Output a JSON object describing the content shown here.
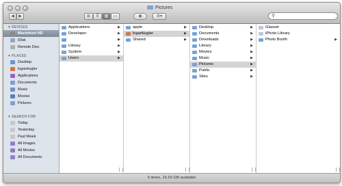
{
  "window": {
    "title": "Pictures"
  },
  "toolbar": {
    "back_glyph": "◀",
    "forward_glyph": "▶",
    "view_icon_glyph": "⊞",
    "view_list_glyph": "☰",
    "view_column_glyph": "▥",
    "view_coverflow_glyph": "▭",
    "eye_glyph": "◉",
    "gear_glyph": "⚙▾",
    "search_glyph": "⚲",
    "search_value": ""
  },
  "sidebar": {
    "devices_header": "DEVICES",
    "places_header": "PLACES",
    "search_header": "SEARCH FOR",
    "devices": [
      {
        "label": "Macintosh HD",
        "icon": "hard-drive-icon",
        "color": "#8a8a8a"
      },
      {
        "label": "iDisk",
        "icon": "idisk-icon",
        "color": "#9aa7b8"
      },
      {
        "label": "Remote Disc",
        "icon": "remote-disc-icon",
        "color": "#b0b0b0"
      }
    ],
    "places": [
      {
        "label": "Desktop",
        "icon": "desktop-icon",
        "color": "#6f94c8"
      },
      {
        "label": "logankugler",
        "icon": "home-icon",
        "color": "#c87a4a"
      },
      {
        "label": "Applications",
        "icon": "applications-icon",
        "color": "#a05fbf"
      },
      {
        "label": "Documents",
        "icon": "documents-icon",
        "color": "#7fa0d0"
      },
      {
        "label": "Music",
        "icon": "music-icon",
        "color": "#6f94c8"
      },
      {
        "label": "Movies",
        "icon": "movies-icon",
        "color": "#5f7fb8"
      },
      {
        "label": "Pictures",
        "icon": "pictures-icon",
        "color": "#7fa0d0"
      }
    ],
    "searches": [
      {
        "label": "Today",
        "icon": "clock-icon",
        "color": "#c8c8c8"
      },
      {
        "label": "Yesterday",
        "icon": "clock-icon",
        "color": "#c8c8c8"
      },
      {
        "label": "Past Week",
        "icon": "clock-icon",
        "color": "#c8c8c8"
      },
      {
        "label": "All Images",
        "icon": "smart-folder-icon",
        "color": "#8f7fc8"
      },
      {
        "label": "All Movies",
        "icon": "smart-folder-icon",
        "color": "#8f7fc8"
      },
      {
        "label": "All Documents",
        "icon": "smart-folder-icon",
        "color": "#8f7fc8"
      }
    ]
  },
  "columns": [
    {
      "items": [
        {
          "label": "Applications",
          "arrow": "▶"
        },
        {
          "label": "Developer",
          "arrow": "▶"
        },
        {
          "label": "",
          "arrow": "▶"
        },
        {
          "label": "Library",
          "arrow": "▶"
        },
        {
          "label": "System",
          "arrow": "▶"
        },
        {
          "label": "Users",
          "arrow": "▶",
          "selected": true
        }
      ]
    },
    {
      "items": [
        {
          "label": "apple",
          "arrow": "▶"
        },
        {
          "label": "logankugler",
          "arrow": "▶",
          "selected": true,
          "home": true
        },
        {
          "label": "Shared",
          "arrow": "▶"
        }
      ]
    },
    {
      "items": [
        {
          "label": "Desktop",
          "arrow": "▶"
        },
        {
          "label": "Documents",
          "arrow": "▶"
        },
        {
          "label": "Downloads",
          "arrow": "▶"
        },
        {
          "label": "Library",
          "arrow": "▶"
        },
        {
          "label": "Movies",
          "arrow": "▶"
        },
        {
          "label": "Music",
          "arrow": "▶"
        },
        {
          "label": "Pictures",
          "arrow": "▶",
          "selected": true
        },
        {
          "label": "Public",
          "arrow": "▶"
        },
        {
          "label": "Sites",
          "arrow": "▶"
        }
      ]
    },
    {
      "items": [
        {
          "label": "Glasset",
          "arrow": ""
        },
        {
          "label": "iPhoto Library",
          "arrow": ""
        },
        {
          "label": "Photo Booth",
          "arrow": "▶"
        }
      ]
    }
  ],
  "status": {
    "text": "3 items, 16.93 GB available"
  },
  "colors": {
    "selection": "#d4d4d4",
    "sidebar_bg": "#dde4eb",
    "folder": "#78a2d6"
  }
}
